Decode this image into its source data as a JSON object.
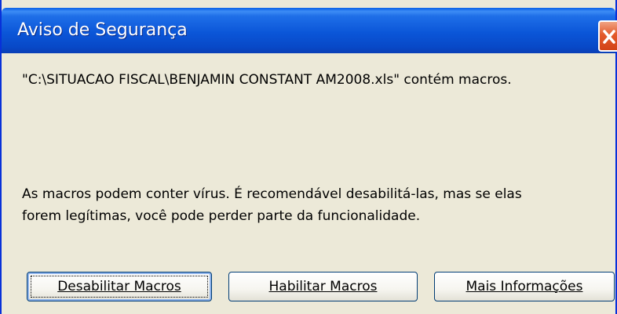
{
  "window": {
    "title": "Aviso de Segurança",
    "close_icon": "close-icon"
  },
  "message": {
    "line1": "\"C:\\SITUACAO FISCAL\\BENJAMIN CONSTANT AM2008.xls\" contém macros.",
    "line2": "As macros podem conter vírus. É recomendável desabilitá-las, mas se elas",
    "line3": "forem legítimas, você pode perder parte da funcionalidade."
  },
  "buttons": {
    "disable_label": "Desabilitar Macros",
    "enable_label": "Habilitar Macros",
    "more_info_label": "Mais Informações"
  },
  "colors": {
    "titlebar": "#0b56d8",
    "dialog_bg": "#ece9d8",
    "close_button": "#e35a2b"
  }
}
